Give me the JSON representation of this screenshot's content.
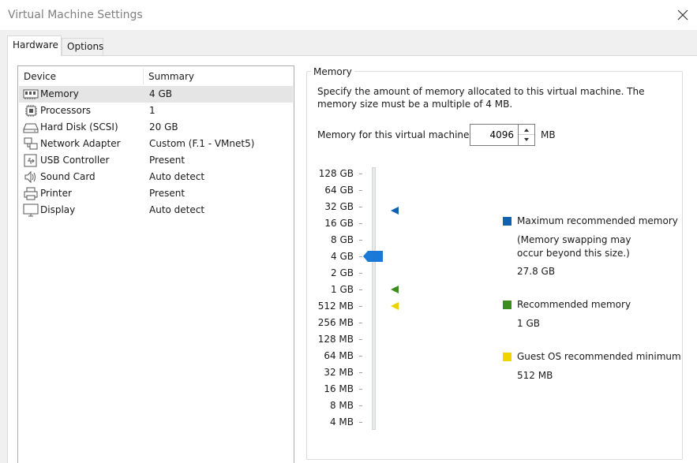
{
  "window": {
    "title": "Virtual Machine Settings"
  },
  "tabs": [
    {
      "label": "Hardware",
      "selected": true
    },
    {
      "label": "Options",
      "selected": false
    }
  ],
  "device_list": {
    "columns": [
      "Device",
      "Summary"
    ],
    "rows": [
      {
        "icon": "memory-icon",
        "name": "Memory",
        "summary": "4 GB",
        "selected": true
      },
      {
        "icon": "processor-icon",
        "name": "Processors",
        "summary": "1",
        "selected": false
      },
      {
        "icon": "hard-disk-icon",
        "name": "Hard Disk (SCSI)",
        "summary": "20 GB",
        "selected": false
      },
      {
        "icon": "network-adapter-icon",
        "name": "Network Adapter",
        "summary": "Custom (F.1 - VMnet5)",
        "selected": false
      },
      {
        "icon": "usb-icon",
        "name": "USB Controller",
        "summary": "Present",
        "selected": false
      },
      {
        "icon": "speaker-icon",
        "name": "Sound Card",
        "summary": "Auto detect",
        "selected": false
      },
      {
        "icon": "printer-icon",
        "name": "Printer",
        "summary": "Present",
        "selected": false
      },
      {
        "icon": "display-icon",
        "name": "Display",
        "summary": "Auto detect",
        "selected": false
      }
    ]
  },
  "memory": {
    "group_title": "Memory",
    "description": "Specify the amount of memory allocated to this virtual machine. The memory size must be a multiple of 4 MB.",
    "input_label": "Memory for this virtual machine:",
    "value": "4096",
    "unit": "MB",
    "scale_labels": [
      "128 GB",
      "64 GB",
      "32 GB",
      "16 GB",
      "8 GB",
      "4 GB",
      "2 GB",
      "1 GB",
      "512 MB",
      "256 MB",
      "128 MB",
      "64 MB",
      "32 MB",
      "16 MB",
      "8 MB",
      "4 MB"
    ],
    "slider_value": "4 GB",
    "markers": {
      "max_recommended": "32 GB",
      "recommended": "1 GB",
      "guest_min": "512 MB"
    },
    "legend": {
      "max": {
        "title": "Maximum recommended memory",
        "note": "(Memory swapping may occur beyond this size.)",
        "value": "27.8 GB",
        "color": "#1061b0"
      },
      "recommended": {
        "title": "Recommended memory",
        "value": "1 GB",
        "color": "#3c8c1e"
      },
      "guest_min": {
        "title": "Guest OS recommended minimum",
        "value": "512 MB",
        "color": "#f0d400"
      }
    }
  },
  "colors": {
    "slider_thumb": "#1a78d6",
    "max_marker": "#1061b0",
    "recommended_marker": "#3c8c1e",
    "guest_min_marker": "#e9d400"
  }
}
